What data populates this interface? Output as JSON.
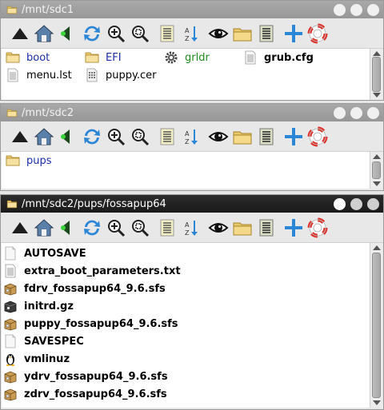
{
  "toolbar_icons": [
    "up-icon",
    "home-icon",
    "back-icon",
    "refresh-icon",
    "zoom-in-icon",
    "zoom-fit-icon",
    "list-view-icon",
    "sort-icon",
    "show-hidden-icon",
    "new-folder-icon",
    "details-icon",
    "add-icon",
    "help-icon"
  ],
  "colors": {
    "folder": "#e9c96b",
    "folder_label": "#1a2ea8",
    "exec_label": "#1f8a1f",
    "accent_blue": "#2c86d6",
    "help_red": "#e0312b"
  },
  "windows": [
    {
      "title": "/mnt/sdc1",
      "active": false,
      "files": [
        {
          "name": "boot",
          "icon": "folder-icon",
          "kind": "folder"
        },
        {
          "name": "EFI",
          "icon": "folder-icon",
          "kind": "folder"
        },
        {
          "name": "grldr",
          "icon": "gear-icon",
          "kind": "exec"
        },
        {
          "name": "grub.cfg",
          "icon": "text-file-icon",
          "kind": "bold"
        },
        {
          "name": "menu.lst",
          "icon": "text-file-icon",
          "kind": "plain"
        },
        {
          "name": "puppy.cer",
          "icon": "cert-file-icon",
          "kind": "plain"
        }
      ]
    },
    {
      "title": "/mnt/sdc2",
      "active": false,
      "files": [
        {
          "name": "pups",
          "icon": "folder-icon",
          "kind": "folder"
        }
      ]
    },
    {
      "title": "/mnt/sdc2/pups/fossapup64",
      "active": true,
      "files": [
        {
          "name": "AUTOSAVE",
          "icon": "blank-file-icon"
        },
        {
          "name": "extra_boot_parameters.txt",
          "icon": "text-file-icon"
        },
        {
          "name": "fdrv_fossapup64_9.6.sfs",
          "icon": "package-icon"
        },
        {
          "name": "initrd.gz",
          "icon": "archive-icon"
        },
        {
          "name": "puppy_fossapup64_9.6.sfs",
          "icon": "package-icon"
        },
        {
          "name": "SAVESPEC",
          "icon": "blank-file-icon"
        },
        {
          "name": "vmlinuz",
          "icon": "penguin-icon"
        },
        {
          "name": "ydrv_fossapup64_9.6.sfs",
          "icon": "package-icon"
        },
        {
          "name": "zdrv_fossapup64_9.6.sfs",
          "icon": "package-icon"
        }
      ]
    }
  ]
}
